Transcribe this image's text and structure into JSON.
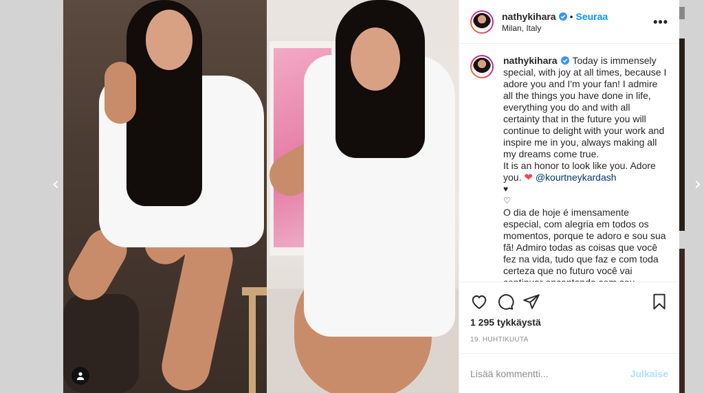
{
  "post": {
    "username": "nathykihara",
    "follow_label": "Seuraa",
    "dot": "•",
    "location": "Milan, Italy",
    "more_label": "•••",
    "caption_en": "Today is immensely special, with joy at all times, because I adore you and I'm your fan! I admire all the things you have done in life, everything you do and with all certainty that in the future you will continue to delight with your work and inspire me in you, always making all my dreams come true.",
    "caption_en_2": "It is an honor to look like you. Adore you.",
    "heart_emoji": "❤",
    "mention": "@kourtneykardash",
    "small_heart_black": "♥",
    "small_heart_white": "♡",
    "caption_pt": "O dia de hoje é imensamente especial, com alegria em todos os momentos, porque te adoro e sou sua fã! Admiro todas as coisas que você fez na vida, tudo que faz e com toda certeza que no futuro você vai continuar encantando com seu trabalho e me",
    "likes": "1 295 tykkäystä",
    "date": "19. huhtikuuta"
  },
  "comment_box": {
    "placeholder": "Lisää kommentti...",
    "post_label": "Julkaise"
  },
  "nav": {
    "prev": "‹",
    "next": "›"
  },
  "icons": {
    "like": "heart-icon",
    "comment": "comment-icon",
    "share": "share-icon",
    "save": "bookmark-icon",
    "verified": "verified-badge-icon",
    "user_tag": "user-tag-icon"
  },
  "colors": {
    "accent": "#0095f6",
    "verified": "#3897f0",
    "heart": "#ed4956",
    "mention": "#00376b"
  }
}
